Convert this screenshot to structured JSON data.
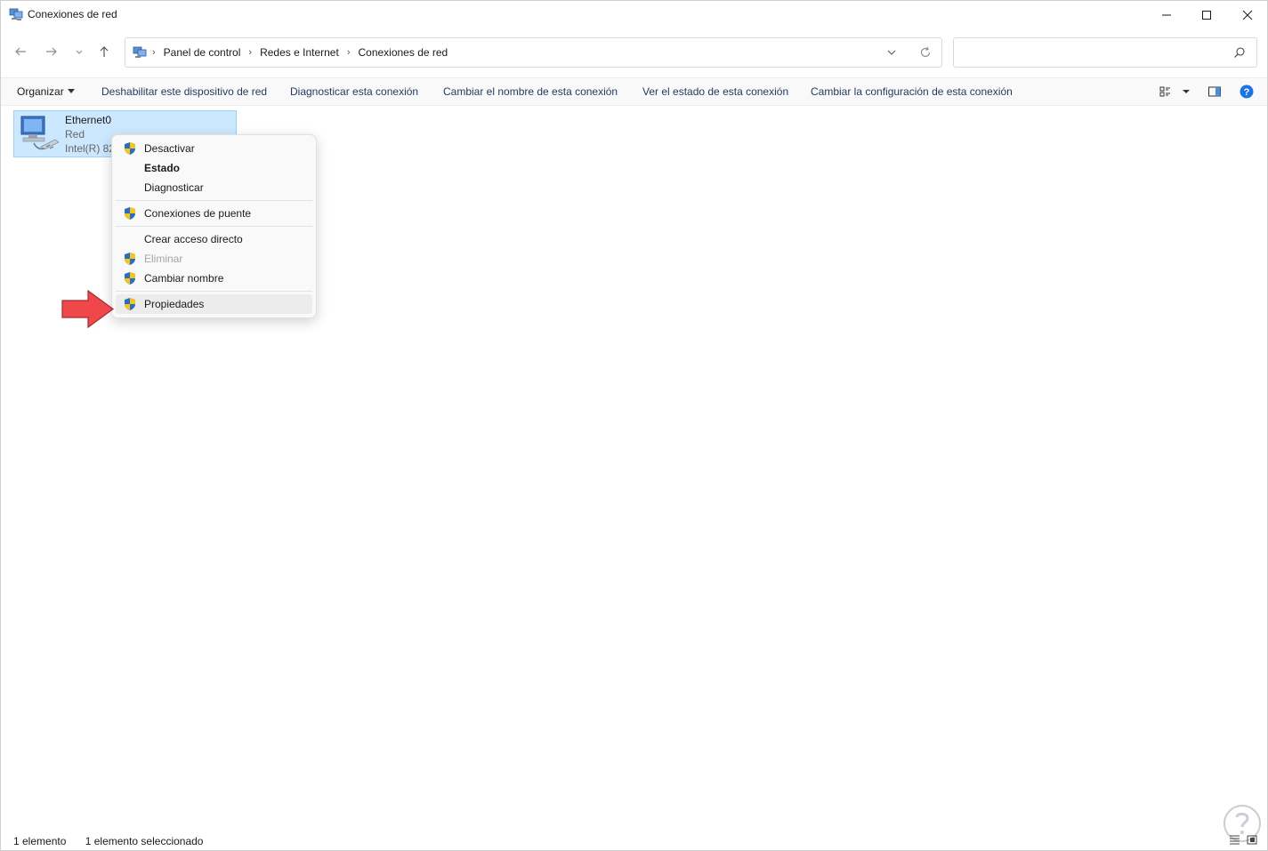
{
  "window": {
    "title": "Conexiones de red",
    "icon": "network-connections-icon"
  },
  "address_bar": {
    "breadcrumbs": [
      "Panel de control",
      "Redes e Internet",
      "Conexiones de red"
    ]
  },
  "search": {
    "placeholder": ""
  },
  "command_bar": {
    "organize": "Organizar",
    "disable": "Deshabilitar este dispositivo de red",
    "diagnose": "Diagnosticar esta conexión",
    "rename": "Cambiar el nombre de esta conexión",
    "view_status": "Ver el estado de esta conexión",
    "change_settings": "Cambiar la configuración de esta conexión"
  },
  "connection": {
    "name": "Ethernet0",
    "status": "Red",
    "device": "Intel(R) 82"
  },
  "context_menu": {
    "items": [
      {
        "label": "Desactivar",
        "shield": true
      },
      {
        "label": "Estado",
        "shield": false,
        "bold": true
      },
      {
        "label": "Diagnosticar",
        "shield": false
      },
      {
        "label": "Conexiones de puente",
        "shield": true
      },
      {
        "label": "Crear acceso directo",
        "shield": false
      },
      {
        "label": "Eliminar",
        "shield": true,
        "disabled": true
      },
      {
        "label": "Cambiar nombre",
        "shield": true
      },
      {
        "label": "Propiedades",
        "shield": true,
        "highlighted": true
      }
    ]
  },
  "status_bar": {
    "count": "1 elemento",
    "selected": "1 elemento seleccionado"
  },
  "colors": {
    "selection": "#cce8ff",
    "selection_border": "#99d1ff",
    "arrow": "#f0474b",
    "help": "#1a73e8",
    "shield_blue": "#2b6cc4",
    "shield_yellow": "#f5c518"
  }
}
